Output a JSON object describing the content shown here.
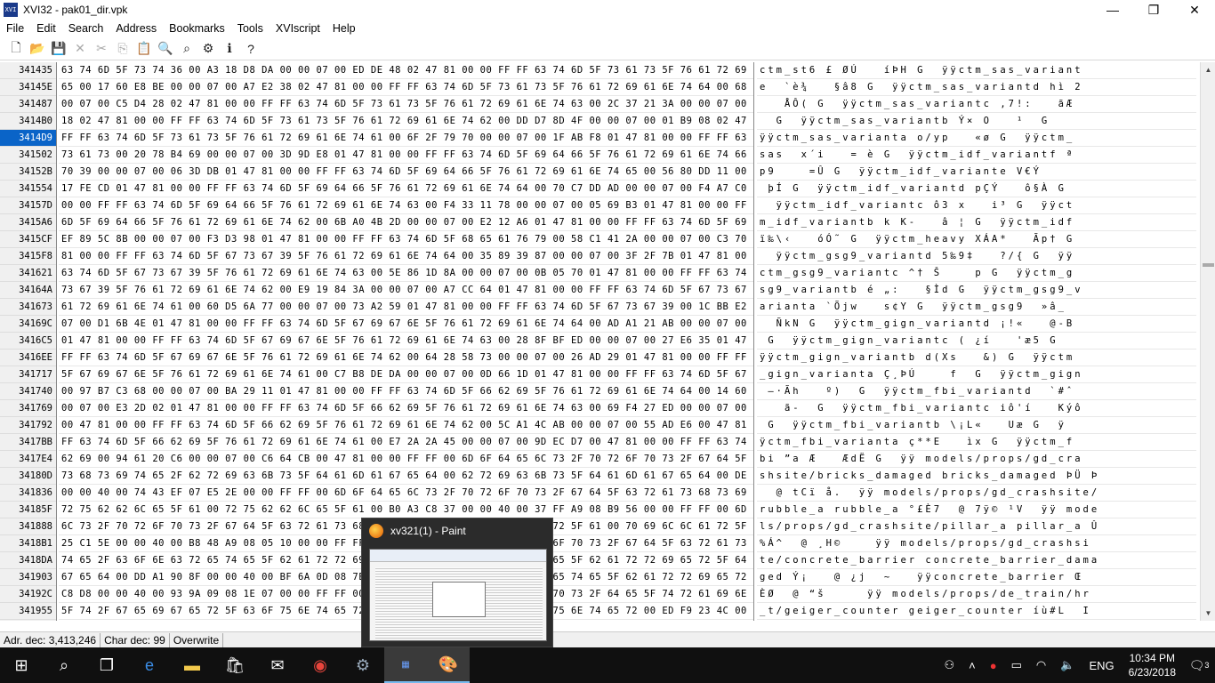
{
  "window": {
    "title": "XVI32 - pak01_dir.vpk",
    "icon_text": "XVI",
    "minimize": "—",
    "maximize": "❐",
    "close": "✕"
  },
  "menu": [
    "File",
    "Edit",
    "Search",
    "Address",
    "Bookmarks",
    "Tools",
    "XVIscript",
    "Help"
  ],
  "toolbar_icons": [
    "new-file-icon",
    "open-folder-icon",
    "save-icon",
    "delete-icon",
    "cut-icon",
    "copy-icon",
    "paste-icon",
    "find-icon",
    "find-next-icon",
    "settings-icon",
    "script-icon",
    "help-icon"
  ],
  "rows": [
    {
      "addr": "341435",
      "hex": "63 74 6D 5F 73 74 36 00 A3 18 D8 DA 00 00 07 00 ED DE 48 02 47 81 00 00 FF FF 63 74 6D 5F 73 61 73 5F 76 61 72 69 61 6E 74",
      "ascii": "ctm_st6 £ ØÚ   íÞH G  ÿÿctm_sas_variant"
    },
    {
      "addr": "34145E",
      "hex": "65 00 17 60 E8 BE 00 00 07 00 A7 E2 38 02 47 81 00 00 FF FF 63 74 6D 5F 73 61 73 5F 76 61 72 69 61 6E 74 64 00 68 EC 02 32",
      "ascii": "e  `è¾   §â8 G  ÿÿctm_sas_variantd hì 2"
    },
    {
      "addr": "341487",
      "hex": "00 07 00 C5 D4 28 02 47 81 00 00 FF FF 63 74 6D 5F 73 61 73 5F 76 61 72 69 61 6E 74 63 00 2C 37 21 3A 00 00 07 00 E3 C6",
      "ascii": "   ÅÔ( G  ÿÿctm_sas_variantc ,7!:   ãÆ"
    },
    {
      "addr": "3414B0",
      "hex": "18 02 47 81 00 00 FF FF 63 74 6D 5F 73 61 73 5F 76 61 72 69 61 6E 74 62 00 DD D7 8D 4F 00 00 07 00 01 B9 08 02 47 81 00 00",
      "ascii": "  G  ÿÿctm_sas_variantb Ý× O   ¹  G"
    },
    {
      "addr": "3414D9",
      "hex": "FF FF 63 74 6D 5F 73 61 73 5F 76 61 72 69 61 6E 74 61 00 6F 2F 79 70 00 00 07 00 1F AB F8 01 47 81 00 00 FF FF 63 74 6D 5F",
      "ascii": "ÿÿctm_sas_varianta o/yp   «ø G  ÿÿctm_",
      "sel": true
    },
    {
      "addr": "341502",
      "hex": "73 61 73 00 20 78 B4 69 00 00 07 00 3D 9D E8 01 47 81 00 00 FF FF 63 74 6D 5F 69 64 66 5F 76 61 72 69 61 6E 74 66 00 AA 01",
      "ascii": "sas  x´i   = è G  ÿÿctm_idf_variantf ª"
    },
    {
      "addr": "34152B",
      "hex": "70 39 00 00 07 00 06 3D DB 01 47 81 00 00 FF FF 63 74 6D 5F 69 64 66 5F 76 61 72 69 61 6E 74 65 00 56 80 DD 11 00 00 07 00",
      "ascii": "p9    =Û G  ÿÿctm_idf_variante V€Ý"
    },
    {
      "addr": "341554",
      "hex": "17 FE CD 01 47 81 00 00 FF FF 63 74 6D 5F 69 64 66 5F 76 61 72 69 61 6E 74 64 00 70 C7 DD AD 00 00 07 00 F4 A7 C0 01 47 81",
      "ascii": " þÍ G  ÿÿctm_idf_variantd pÇÝ­   ô§À G"
    },
    {
      "addr": "34157D",
      "hex": "00 00 FF FF 63 74 6D 5F 69 64 66 5F 76 61 72 69 61 6E 74 63 00 F4 33 11 78 00 00 07 00 05 69 B3 01 47 81 00 00 FF FF 63 74",
      "ascii": "  ÿÿctm_idf_variantc ô3 x   i³ G  ÿÿct"
    },
    {
      "addr": "3415A6",
      "hex": "6D 5F 69 64 66 5F 76 61 72 69 61 6E 74 62 00 6B A0 4B 2D 00 00 07 00 E2 12 A6 01 47 81 00 00 FF FF 63 74 6D 5F 69 64 66",
      "ascii": "m_idf_variantb k K-   â ¦ G  ÿÿctm_idf"
    },
    {
      "addr": "3415CF",
      "hex": "EF 89 5C 8B 00 00 07 00 F3 D3 98 01 47 81 00 00 FF FF 63 74 6D 5F 68 65 61 76 79 00 58 C1 41 2A 00 00 07 00 C3 70 86 01 47",
      "ascii": "ï‰\\‹   óÓ˜ G  ÿÿctm_heavy XÁA*   Ãp† G"
    },
    {
      "addr": "3415F8",
      "hex": "81 00 00 FF FF 63 74 6D 5F 67 73 67 39 5F 76 61 72 69 61 6E 74 64 00 35 89 39 87 00 00 07 00 3F 2F 7B 01 47 81 00 00 FF FF",
      "ascii": "  ÿÿctm_gsg9_variantd 5‰9‡   ?/{ G  ÿÿ"
    },
    {
      "addr": "341621",
      "hex": "63 74 6D 5F 67 73 67 39 5F 76 61 72 69 61 6E 74 63 00 5E 86 1D 8A 00 00 07 00 0B 05 70 01 47 81 00 00 FF FF 63 74 6D 5F 67",
      "ascii": "ctm_gsg9_variantc ^† Š    p G  ÿÿctm_g"
    },
    {
      "addr": "34164A",
      "hex": "73 67 39 5F 76 61 72 69 61 6E 74 62 00 E9 19 84 3A 00 00 07 00 A7 CC 64 01 47 81 00 00 FF FF 63 74 6D 5F 67 73 67 39 5F 76",
      "ascii": "sg9_variantb é „:   §Ìd G  ÿÿctm_gsg9_v"
    },
    {
      "addr": "341673",
      "hex": "61 72 69 61 6E 74 61 00 60 D5 6A 77 00 00 07 00 73 A2 59 01 47 81 00 00 FF FF 63 74 6D 5F 67 73 67 39 00 1C BB E2 5F 00 00",
      "ascii": "arianta `Õjw   s¢Y G  ÿÿctm_gsg9  »â_"
    },
    {
      "addr": "34169C",
      "hex": "07 00 D1 6B 4E 01 47 81 00 00 FF FF 63 74 6D 5F 67 69 67 6E 5F 76 61 72 69 61 6E 74 64 00 AD A1 21 AB 00 00 07 00 40 2D 42",
      "ascii": "  ÑkN G  ÿÿctm_gign_variantd ­¡!«   @-B"
    },
    {
      "addr": "3416C5",
      "hex": "01 47 81 00 00 FF FF 63 74 6D 5F 67 69 67 6E 5F 76 61 72 69 61 6E 74 63 00 28 8F BF ED 00 00 07 00 27 E6 35 01 47 81 00 00",
      "ascii": " G  ÿÿctm_gign_variantc ( ¿í   'æ5 G"
    },
    {
      "addr": "3416EE",
      "hex": "FF FF 63 74 6D 5F 67 69 67 6E 5F 76 61 72 69 61 6E 74 62 00 64 28 58 73 00 00 07 00 26 AD 29 01 47 81 00 00 FF FF 63 74 6D",
      "ascii": "ÿÿctm_gign_variantb d(Xs   &­) G  ÿÿctm"
    },
    {
      "addr": "341717",
      "hex": "5F 67 69 67 6E 5F 76 61 72 69 61 6E 74 61 00 C7 B8 DE DA 00 00 07 00 0D 66 1D 01 47 81 00 00 FF FF 63 74 6D 5F 67 69 67 6E",
      "ascii": "_gign_varianta Ç¸ÞÚ    f  G  ÿÿctm_gign"
    },
    {
      "addr": "341740",
      "hex": "00 97 B7 C3 68 00 00 07 00 BA 29 11 01 47 81 00 00 FF FF 63 74 6D 5F 66 62 69 5F 76 61 72 69 61 6E 74 64 00 14 60 23 88 00",
      "ascii": " —·Ãh   º)  G  ÿÿctm_fbi_variantd  `#ˆ"
    },
    {
      "addr": "341769",
      "hex": "00 07 00 E3 2D 02 01 47 81 00 00 FF FF 63 74 6D 5F 66 62 69 5F 76 61 72 69 61 6E 74 63 00 69 F4 27 ED 00 00 07 00 4B FD F4",
      "ascii": "   ã-  G  ÿÿctm_fbi_variantc iô'í   Kýô"
    },
    {
      "addr": "341792",
      "hex": "00 47 81 00 00 FF FF 63 74 6D 5F 66 62 69 5F 76 61 72 69 61 6E 74 62 00 5C A1 4C AB 00 00 07 00 55 AD E6 00 47 81 00 00 FF",
      "ascii": " G  ÿÿctm_fbi_variantb \\¡L«   U­æ G  ÿ"
    },
    {
      "addr": "3417BB",
      "hex": "FF 63 74 6D 5F 66 62 69 5F 76 61 72 69 61 6E 74 61 00 E7 2A 2A 45 00 00 07 00 9D EC D7 00 47 81 00 00 FF FF 63 74 6D 5F 66",
      "ascii": "ÿctm_fbi_varianta ç**E   ìx G  ÿÿctm_f"
    },
    {
      "addr": "3417E4",
      "hex": "62 69 00 94 61 20 C6 00 00 07 00 C6 64 CB 00 47 81 00 00 FF FF 00 6D 6F 64 65 6C 73 2F 70 72 6F 70 73 2F 67 64 5F 63 72 61",
      "ascii": "bi ”a Æ   ÆdË G  ÿÿ models/props/gd_cra"
    },
    {
      "addr": "34180D",
      "hex": "73 68 73 69 74 65 2F 62 72 69 63 6B 73 5F 64 61 6D 61 67 65 64 00 62 72 69 63 6B 73 5F 64 61 6D 61 67 65 64 00 DE DC 0A DE",
      "ascii": "shsite/bricks_damaged bricks_damaged ÞÜ Þ"
    },
    {
      "addr": "341836",
      "hex": "00 00 40 00 74 43 EF 07 E5 2E 00 00 FF FF 00 6D 6F 64 65 6C 73 2F 70 72 6F 70 73 2F 67 64 5F 63 72 61 73 68 73 69 74 65 2F",
      "ascii": "  @ tCï å.  ÿÿ models/props/gd_crashsite/"
    },
    {
      "addr": "34185F",
      "hex": "72 75 62 62 6C 65 5F 61 00 72 75 62 62 6C 65 5F 61 00 B0 A3 C8 37 00 00 40 00 37 FF A9 08 B9 56 00 00 FF FF 00 6D 6F 64 65",
      "ascii": "rubble_a rubble_a °£È7  @ 7ÿ© ¹V  ÿÿ mode"
    },
    {
      "addr": "341888",
      "hex": "6C 73 2F 70 72 6F 70 73 2F 67 64 5F 63 72 61 73 68 73 69 74 65 2F 70 69 6C 6C 61 72 5F 61 00 70 69 6C 6C 61 72 5F 61 00 DB",
      "ascii": "ls/props/gd_crashsite/pillar_a pillar_a Û"
    },
    {
      "addr": "3418B1",
      "hex": "25 C1 5E 00 00 40 00 B8 48 A9 08 05 10 00 00 FF FF 00 6D 6F 64 65 6C 73 2F 70 72 6F 70 73 2F 67 64 5F 63 72 61 73 68 73 69",
      "ascii": "%Á^  @ ¸H©    ÿÿ models/props/gd_crashsi"
    },
    {
      "addr": "3418DA",
      "hex": "74 65 2F 63 6F 6E 63 72 65 74 65 5F 62 61 72 72 69 65 72 00 63 6F 6E 63 72 65 74 65 5F 62 61 72 72 69 65 72 5F 64 61 6D 61",
      "ascii": "te/concrete_barrier concrete_barrier_dama"
    },
    {
      "addr": "341903",
      "hex": "67 65 64 00 DD A1 90 8F 00 00 40 00 BF 6A 0D 08 7E 12 00 00 FF FF 63 6F 6E 63 72 65 74 65 5F 62 61 72 72 69 65 72 00 8C",
      "ascii": "ged Ý¡   @ ¿j  ~   ÿÿconcrete_barrier Œ"
    },
    {
      "addr": "34192C",
      "hex": "C8 D8 00 00 40 00 93 9A 09 08 1E 07 00 00 FF FF 00 6D 6F 64 65 6C 73 2F 70 72 6F 70 73 2F 64 65 5F 74 72 61 69 6E 2F 68 72",
      "ascii": "ÈØ  @ “š     ÿÿ models/props/de_train/hr"
    },
    {
      "addr": "341955",
      "hex": "5F 74 2F 67 65 69 67 65 72 5F 63 6F 75 6E 74 65 72 00 67 65 69 67 65 72 5F 63 6F 75 6E 74 65 72 00 ED F9 23 4C 00 00 49 00",
      "ascii": "_t/geiger_counter geiger_counter íù#L  I"
    }
  ],
  "status": {
    "addr_dec": "Adr. dec: 3,413,246",
    "char_dec": "Char dec: 99",
    "mode": "Overwrite"
  },
  "taskbar": {
    "preview_title": "xv321(1) - Paint",
    "ime": "ENG",
    "time": "10:34 PM",
    "date": "6/23/2018",
    "notifications": "3"
  }
}
